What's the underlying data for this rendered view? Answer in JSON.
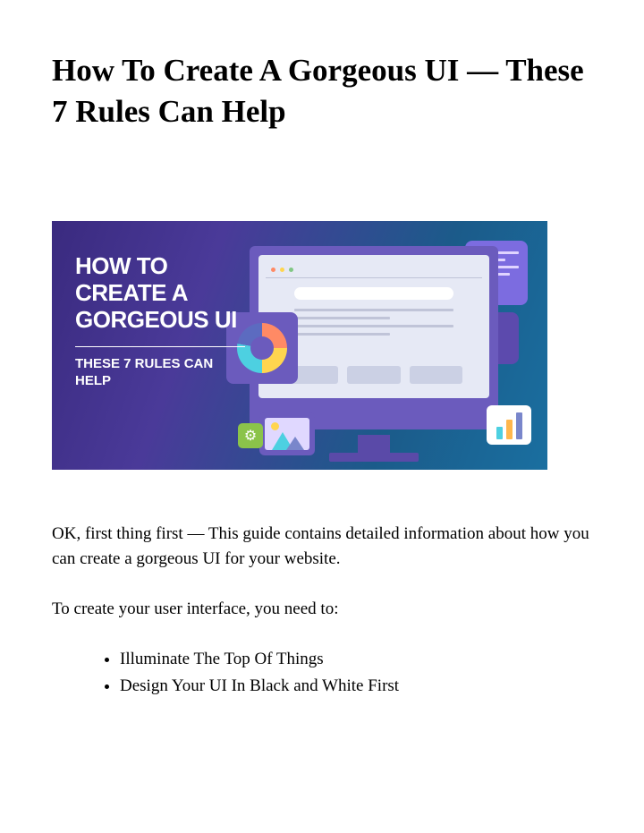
{
  "title": "How To Create A Gorgeous  UI — These 7 Rules Can Help",
  "hero": {
    "main_line1": "HOW TO",
    "main_line2": "CREATE A",
    "main_line3": "GORGEOUS UI",
    "sub_line1": "THESE 7 RULES CAN",
    "sub_line2": "HELP"
  },
  "paragraph": "OK, first thing first — This guide contains detailed information about how you can create a gorgeous UI for your website.",
  "list_intro": "To create your user interface, you need to:",
  "bullets": {
    "0": "Illuminate The Top Of Things",
    "1": "Design Your UI In Black and White First"
  }
}
